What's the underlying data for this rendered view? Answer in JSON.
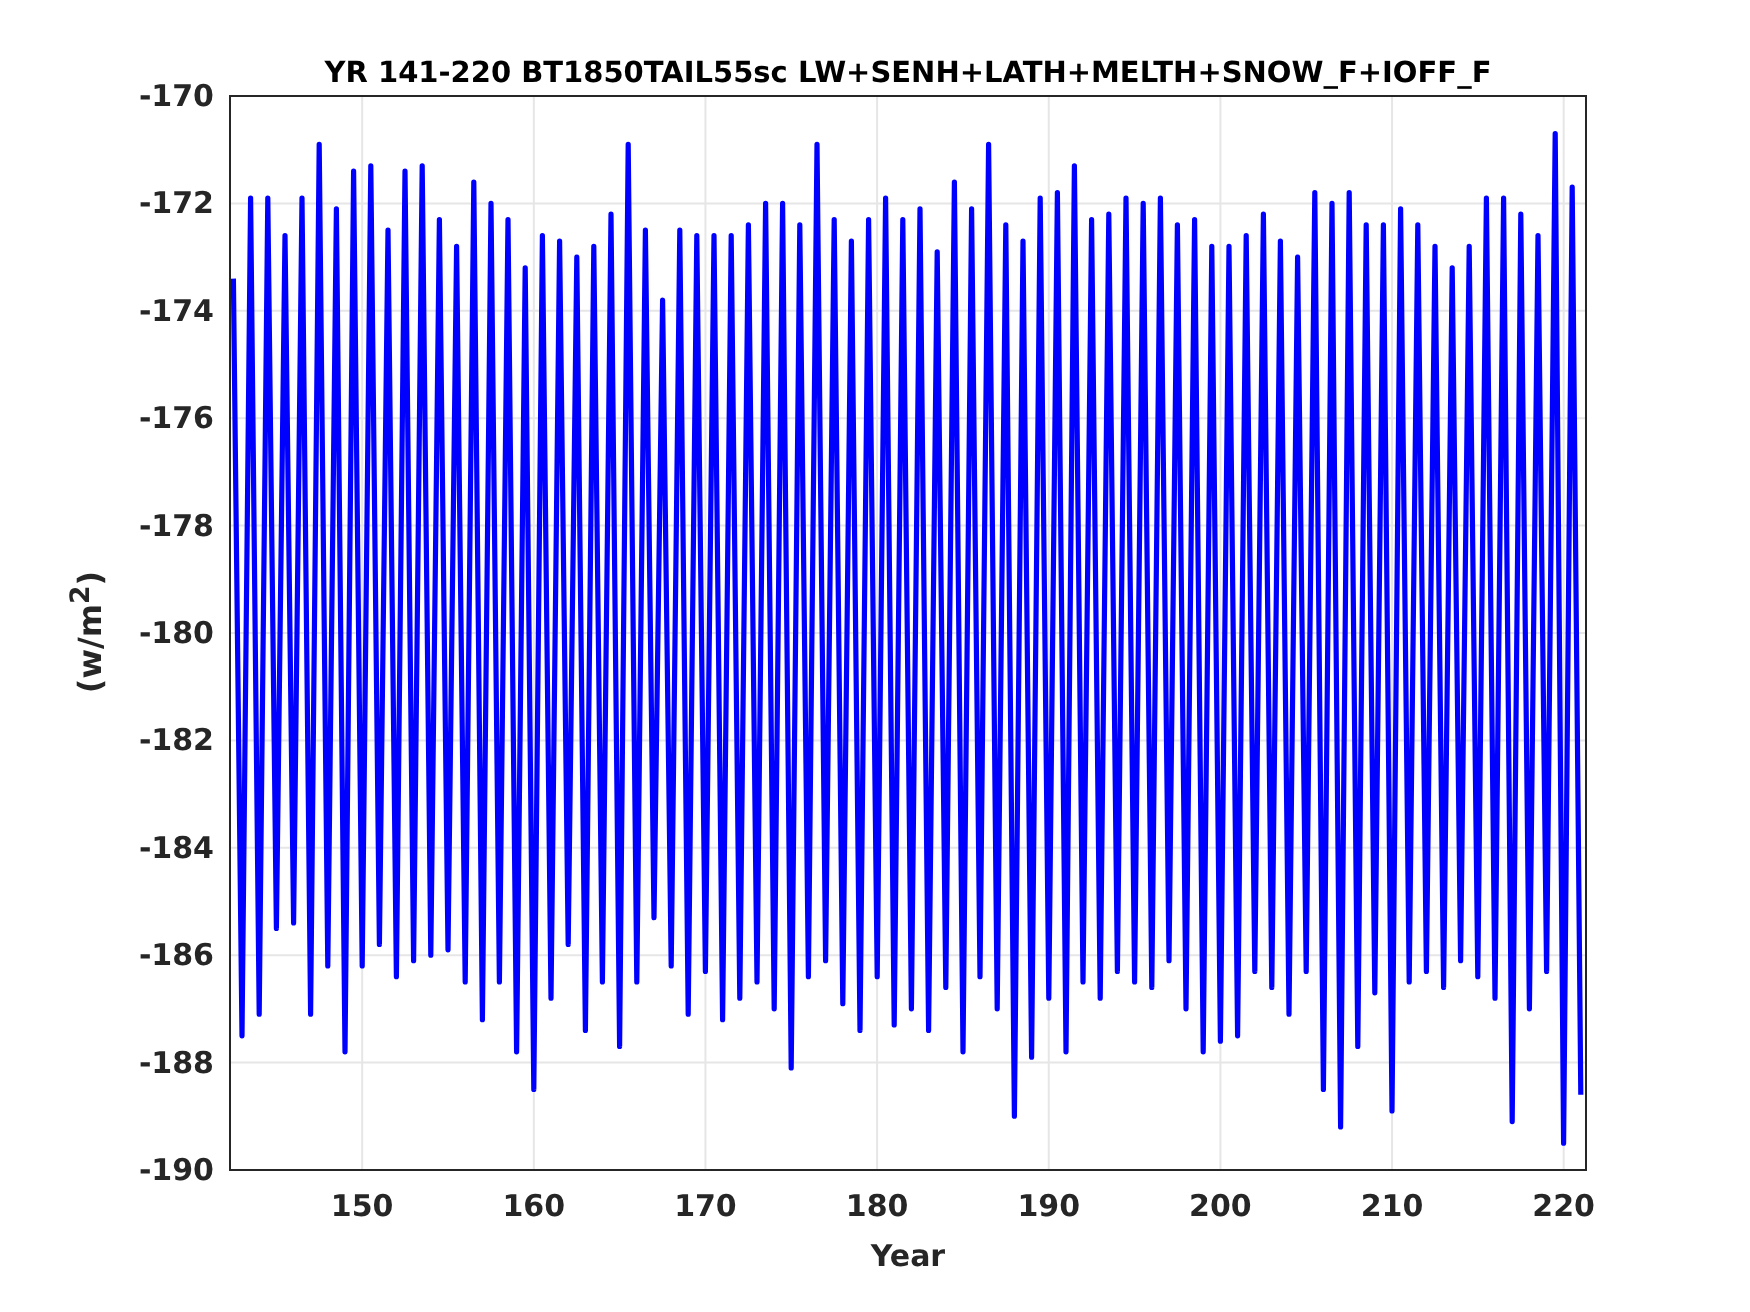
{
  "chart_data": {
    "type": "line",
    "title": "YR 141-220 BT1850TAIL55sc LW+SENH+LATH+MELTH+SNOW_F+IOFF_F",
    "xlabel": "Year",
    "ylabel": "(w/m$^{2}$)",
    "xlim": [
      142.3,
      221.3
    ],
    "grid": true,
    "ylim": [
      -190,
      -170
    ],
    "xticks": [
      150,
      160,
      170,
      180,
      190,
      200,
      210,
      220
    ],
    "yticks": [
      {
        "value": -190,
        "label": "-190"
      },
      {
        "value": -188,
        "label": "-188"
      },
      {
        "value": -186,
        "label": "-186"
      },
      {
        "value": -184,
        "label": "-184"
      },
      {
        "value": -182,
        "label": "-182"
      },
      {
        "value": -180,
        "label": "-180"
      },
      {
        "value": -178,
        "label": "-178"
      },
      {
        "value": -176,
        "label": "-176"
      },
      {
        "value": -174,
        "label": "-174"
      },
      {
        "value": -172,
        "label": "-172"
      },
      {
        "value": -170,
        "label": "-170"
      }
    ],
    "x": [
      142.5,
      143,
      143.5,
      144,
      144.5,
      145,
      145.5,
      146,
      146.5,
      147,
      147.5,
      148,
      148.5,
      149,
      149.5,
      150,
      150.5,
      151,
      151.5,
      152,
      152.5,
      153,
      153.5,
      154,
      154.5,
      155,
      155.5,
      156,
      156.5,
      157,
      157.5,
      158,
      158.5,
      159,
      159.5,
      160,
      160.5,
      161,
      161.5,
      162,
      162.5,
      163,
      163.5,
      164,
      164.5,
      165,
      165.5,
      166,
      166.5,
      167,
      167.5,
      168,
      168.5,
      169,
      169.5,
      170,
      170.5,
      171,
      171.5,
      172,
      172.5,
      173,
      173.5,
      174,
      174.5,
      175,
      175.5,
      176,
      176.5,
      177,
      177.5,
      178,
      178.5,
      179,
      179.5,
      180,
      180.5,
      181,
      181.5,
      182,
      182.5,
      183,
      183.5,
      184,
      184.5,
      185,
      185.5,
      186,
      186.5,
      187,
      187.5,
      188,
      188.5,
      189,
      189.5,
      190,
      190.5,
      191,
      191.5,
      192,
      192.5,
      193,
      193.5,
      194,
      194.5,
      195,
      195.5,
      196,
      196.5,
      197,
      197.5,
      198,
      198.5,
      199,
      199.5,
      200,
      200.5,
      201,
      201.5,
      202,
      202.5,
      203,
      203.5,
      204,
      204.5,
      205,
      205.5,
      206,
      206.5,
      207,
      207.5,
      208,
      208.5,
      209,
      209.5,
      210,
      210.5,
      211,
      211.5,
      212,
      212.5,
      213,
      213.5,
      214,
      214.5,
      215,
      215.5,
      216,
      216.5,
      217,
      217.5,
      218,
      218.5,
      219,
      219.5,
      220,
      220.5,
      221
    ],
    "series": [
      {
        "color": "#0000ff",
        "values": [
          -173.4,
          -187.5,
          -171.9,
          -187.1,
          -171.9,
          -185.5,
          -172.6,
          -185.4,
          -171.9,
          -187.1,
          -170.9,
          -186.2,
          -172.1,
          -187.8,
          -171.4,
          -186.2,
          -171.3,
          -185.8,
          -172.5,
          -186.4,
          -171.4,
          -186.1,
          -171.3,
          -186.0,
          -172.3,
          -185.9,
          -172.8,
          -186.5,
          -171.6,
          -187.2,
          -172.0,
          -186.5,
          -172.3,
          -187.8,
          -173.2,
          -188.5,
          -172.6,
          -186.8,
          -172.7,
          -185.8,
          -173.0,
          -187.4,
          -172.8,
          -186.5,
          -172.2,
          -187.7,
          -170.9,
          -186.5,
          -172.5,
          -185.3,
          -173.8,
          -186.2,
          -172.5,
          -187.1,
          -172.6,
          -186.3,
          -172.6,
          -187.2,
          -172.6,
          -186.8,
          -172.4,
          -186.5,
          -172.0,
          -187.0,
          -172.0,
          -188.1,
          -172.4,
          -186.4,
          -170.9,
          -186.1,
          -172.3,
          -186.9,
          -172.7,
          -187.4,
          -172.3,
          -186.4,
          -171.9,
          -187.3,
          -172.3,
          -187.0,
          -172.1,
          -187.4,
          -172.9,
          -186.6,
          -171.6,
          -187.8,
          -172.1,
          -186.4,
          -170.9,
          -187.0,
          -172.4,
          -189.0,
          -172.7,
          -187.9,
          -171.9,
          -186.8,
          -171.8,
          -187.8,
          -171.3,
          -186.5,
          -172.3,
          -186.8,
          -172.2,
          -186.3,
          -171.9,
          -186.5,
          -172.0,
          -186.6,
          -171.9,
          -186.1,
          -172.4,
          -187.0,
          -172.3,
          -187.8,
          -172.8,
          -187.6,
          -172.8,
          -187.5,
          -172.6,
          -186.3,
          -172.2,
          -186.6,
          -172.7,
          -187.1,
          -173.0,
          -186.3,
          -171.8,
          -188.5,
          -172.0,
          -189.2,
          -171.8,
          -187.7,
          -172.4,
          -186.7,
          -172.4,
          -188.9,
          -172.1,
          -186.5,
          -172.4,
          -186.3,
          -172.8,
          -186.6,
          -173.2,
          -186.1,
          -172.8,
          -186.4,
          -171.9,
          -186.8,
          -171.9,
          -189.1,
          -172.2,
          -187.0,
          -172.6,
          -186.3,
          -170.7,
          -189.5,
          -171.7,
          -188.6
        ]
      }
    ]
  }
}
